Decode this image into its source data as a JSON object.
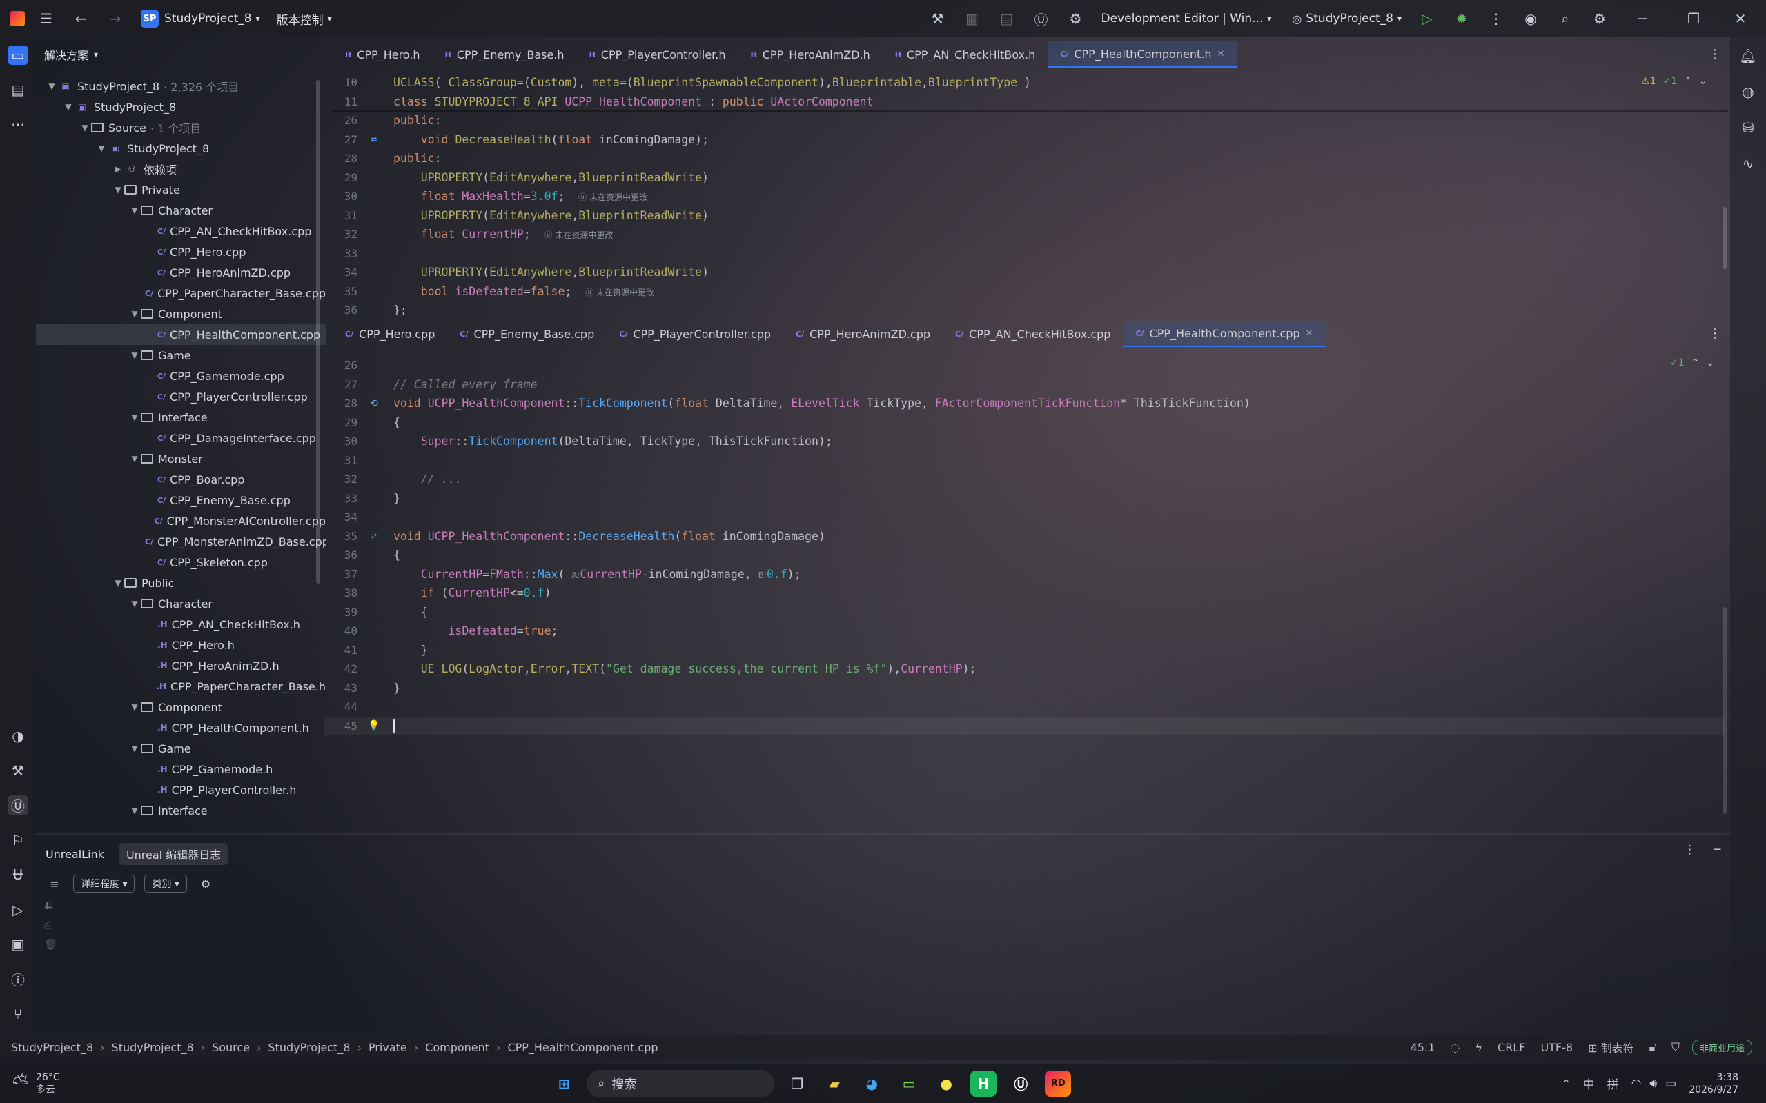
{
  "titlebar": {
    "project": "StudyProject_8",
    "project_badge": "SP",
    "vcs": "版本控制",
    "config": "Development Editor | Win...",
    "run_target": "StudyProject_8"
  },
  "solution": {
    "header": "解决方案"
  },
  "tree": [
    {
      "label": "StudyProject_8",
      "meta": "· 2,326 个项目",
      "indent": 0,
      "arrow": "▼",
      "icon": "sln"
    },
    {
      "label": "StudyProject_8",
      "meta": "",
      "indent": 1,
      "arrow": "▼",
      "icon": "uproj"
    },
    {
      "label": "Source",
      "meta": "· 1 个项目",
      "indent": 2,
      "arrow": "▼",
      "icon": "folder"
    },
    {
      "label": "StudyProject_8",
      "meta": "",
      "indent": 3,
      "arrow": "▼",
      "icon": "proj"
    },
    {
      "label": "依赖项",
      "meta": "",
      "indent": 4,
      "arrow": "▶",
      "icon": "deps"
    },
    {
      "label": "Private",
      "meta": "",
      "indent": 4,
      "arrow": "▼",
      "icon": "folder"
    },
    {
      "label": "Character",
      "meta": "",
      "indent": 5,
      "arrow": "▼",
      "icon": "folder"
    },
    {
      "label": "CPP_AN_CheckHitBox.cpp",
      "meta": "",
      "indent": 6,
      "arrow": "",
      "icon": "cpp"
    },
    {
      "label": "CPP_Hero.cpp",
      "meta": "",
      "indent": 6,
      "arrow": "",
      "icon": "cpp"
    },
    {
      "label": "CPP_HeroAnimZD.cpp",
      "meta": "",
      "indent": 6,
      "arrow": "",
      "icon": "cpp"
    },
    {
      "label": "CPP_PaperCharacter_Base.cpp",
      "meta": "",
      "indent": 6,
      "arrow": "",
      "icon": "cpp"
    },
    {
      "label": "Component",
      "meta": "",
      "indent": 5,
      "arrow": "▼",
      "icon": "folder"
    },
    {
      "label": "CPP_HealthComponent.cpp",
      "meta": "",
      "indent": 6,
      "arrow": "",
      "icon": "cpp",
      "selected": true
    },
    {
      "label": "Game",
      "meta": "",
      "indent": 5,
      "arrow": "▼",
      "icon": "folder"
    },
    {
      "label": "CPP_Gamemode.cpp",
      "meta": "",
      "indent": 6,
      "arrow": "",
      "icon": "cpp"
    },
    {
      "label": "CPP_PlayerController.cpp",
      "meta": "",
      "indent": 6,
      "arrow": "",
      "icon": "cpp"
    },
    {
      "label": "Interface",
      "meta": "",
      "indent": 5,
      "arrow": "▼",
      "icon": "folder"
    },
    {
      "label": "CPP_DamageInterface.cpp",
      "meta": "",
      "indent": 6,
      "arrow": "",
      "icon": "cpp"
    },
    {
      "label": "Monster",
      "meta": "",
      "indent": 5,
      "arrow": "▼",
      "icon": "folder"
    },
    {
      "label": "CPP_Boar.cpp",
      "meta": "",
      "indent": 6,
      "arrow": "",
      "icon": "cpp"
    },
    {
      "label": "CPP_Enemy_Base.cpp",
      "meta": "",
      "indent": 6,
      "arrow": "",
      "icon": "cpp"
    },
    {
      "label": "CPP_MonsterAIController.cpp",
      "meta": "",
      "indent": 6,
      "arrow": "",
      "icon": "cpp"
    },
    {
      "label": "CPP_MonsterAnimZD_Base.cpp",
      "meta": "",
      "indent": 6,
      "arrow": "",
      "icon": "cpp"
    },
    {
      "label": "CPP_Skeleton.cpp",
      "meta": "",
      "indent": 6,
      "arrow": "",
      "icon": "cpp"
    },
    {
      "label": "Public",
      "meta": "",
      "indent": 4,
      "arrow": "▼",
      "icon": "folder"
    },
    {
      "label": "Character",
      "meta": "",
      "indent": 5,
      "arrow": "▼",
      "icon": "folder"
    },
    {
      "label": "CPP_AN_CheckHitBox.h",
      "meta": "",
      "indent": 6,
      "arrow": "",
      "icon": "h"
    },
    {
      "label": "CPP_Hero.h",
      "meta": "",
      "indent": 6,
      "arrow": "",
      "icon": "h"
    },
    {
      "label": "CPP_HeroAnimZD.h",
      "meta": "",
      "indent": 6,
      "arrow": "",
      "icon": "h"
    },
    {
      "label": "CPP_PaperCharacter_Base.h",
      "meta": "",
      "indent": 6,
      "arrow": "",
      "icon": "h"
    },
    {
      "label": "Component",
      "meta": "",
      "indent": 5,
      "arrow": "▼",
      "icon": "folder"
    },
    {
      "label": "CPP_HealthComponent.h",
      "meta": "",
      "indent": 6,
      "arrow": "",
      "icon": "h"
    },
    {
      "label": "Game",
      "meta": "",
      "indent": 5,
      "arrow": "▼",
      "icon": "folder"
    },
    {
      "label": "CPP_Gamemode.h",
      "meta": "",
      "indent": 6,
      "arrow": "",
      "icon": "h"
    },
    {
      "label": "CPP_PlayerController.h",
      "meta": "",
      "indent": 6,
      "arrow": "",
      "icon": "h"
    },
    {
      "label": "Interface",
      "meta": "",
      "indent": 5,
      "arrow": "▼",
      "icon": "folder"
    }
  ],
  "top_tabs": [
    {
      "label": "CPP_Hero.h",
      "icon": "H"
    },
    {
      "label": "CPP_Enemy_Base.h",
      "icon": "H"
    },
    {
      "label": "CPP_PlayerController.h",
      "icon": "H"
    },
    {
      "label": "CPP_HeroAnimZD.h",
      "icon": "H"
    },
    {
      "label": "CPP_AN_CheckHitBox.h",
      "icon": "H"
    },
    {
      "label": "CPP_HealthComponent.h",
      "icon": "C/",
      "active": true
    }
  ],
  "bottom_tabs": [
    {
      "label": "CPP_Hero.cpp",
      "icon": "C/"
    },
    {
      "label": "CPP_Enemy_Base.cpp",
      "icon": "C/"
    },
    {
      "label": "CPP_PlayerController.cpp",
      "icon": "C/"
    },
    {
      "label": "CPP_HeroAnimZD.cpp",
      "icon": "C/"
    },
    {
      "label": "CPP_AN_CheckHitBox.cpp",
      "icon": "C/"
    },
    {
      "label": "CPP_HealthComponent.cpp",
      "icon": "C/",
      "active": true
    }
  ],
  "top_inspection": {
    "warn": "⚠1",
    "ok": "✓1"
  },
  "bottom_inspection": {
    "ok": "✓1"
  },
  "header_code": [
    {
      "n": "10",
      "g": "",
      "html": "<span class='mac'>UCLASS</span>( <span class='mac'>ClassGroup</span>=(<span class='mac'>Custom</span>), <span class='mac'>meta</span>=(<span class='mac'>BlueprintSpawnableComponent</span>),<span class='mac'>Blueprintable</span>,<span class='mac'>BlueprintType</span> )"
    },
    {
      "n": "11",
      "g": "",
      "html": "<span class='kw'>class</span> <span class='mac'>STUDYPROJECT_8_API</span> <span class='ty'>UCPP_HealthComponent</span> : <span class='kw'>public</span> <span class='ty'>UActorComponent</span>"
    },
    {
      "n": "26",
      "g": "",
      "html": "<span class='kw'>public</span>:"
    },
    {
      "n": "27",
      "g": "⇄",
      "html": "    <span class='kw'>void</span> <span class='mac'>DecreaseHealth</span>(<span class='kw'>float</span> inComingDamage);"
    },
    {
      "n": "28",
      "g": "",
      "html": "<span class='kw'>public</span>:"
    },
    {
      "n": "29",
      "g": "",
      "html": "    <span class='mac'>UPROPERTY</span>(<span class='mac'>EditAnywhere</span>,<span class='mac'>BlueprintReadWrite</span>)"
    },
    {
      "n": "30",
      "g": "",
      "html": "    <span class='kw'>float</span> <span class='fld'>MaxHealth</span>=<span class='num'>3.0f</span>;  <span class='hint'>ⓤ 未在资源中更改</span>"
    },
    {
      "n": "31",
      "g": "",
      "html": "    <span class='mac'>UPROPERTY</span>(<span class='mac'>EditAnywhere</span>,<span class='mac'>BlueprintReadWrite</span>)"
    },
    {
      "n": "32",
      "g": "",
      "html": "    <span class='kw'>float</span> <span class='fld'>CurrentHP</span>;  <span class='hint'>ⓤ 未在资源中更改</span>"
    },
    {
      "n": "33",
      "g": "",
      "html": ""
    },
    {
      "n": "34",
      "g": "",
      "html": "    <span class='mac'>UPROPERTY</span>(<span class='mac'>EditAnywhere</span>,<span class='mac'>BlueprintReadWrite</span>)"
    },
    {
      "n": "35",
      "g": "",
      "html": "    <span class='kw'>bool</span> <span class='fld'>isDefeated</span>=<span class='kw'>false</span>;  <span class='hint'>ⓤ 未在资源中更改</span>"
    },
    {
      "n": "36",
      "g": "",
      "html": "};"
    }
  ],
  "cpp_code": [
    {
      "n": "26",
      "g": "",
      "html": ""
    },
    {
      "n": "27",
      "g": "",
      "html": "<span class='cm'>// Called every frame</span>"
    },
    {
      "n": "28",
      "g": "⟲",
      "html": "<span class='kw'>void</span> <span class='ty'>UCPP_HealthComponent</span>::<span class='fn'>TickComponent</span>(<span class='kw'>float</span> DeltaTime, <span class='ty'>ELevelTick</span> TickType, <span class='ty'>FActorComponentTickFunction</span>* ThisTickFunction)"
    },
    {
      "n": "29",
      "g": "",
      "html": "{"
    },
    {
      "n": "30",
      "g": "",
      "html": "    <span class='ty'>Super</span>::<span class='fn'>TickComponent</span>(DeltaTime, TickType, ThisTickFunction);"
    },
    {
      "n": "31",
      "g": "",
      "html": ""
    },
    {
      "n": "32",
      "g": "",
      "html": "    <span class='cm'>// ...</span>"
    },
    {
      "n": "33",
      "g": "",
      "html": "}"
    },
    {
      "n": "34",
      "g": "",
      "html": ""
    },
    {
      "n": "35",
      "g": "⇄",
      "html": "<span class='kw'>void</span> <span class='ty'>UCPP_HealthComponent</span>::<span class='fn'>DecreaseHealth</span>(<span class='kw'>float</span> inComingDamage)"
    },
    {
      "n": "36",
      "g": "",
      "html": "{"
    },
    {
      "n": "37",
      "g": "",
      "html": "    <span class='fld'>CurrentHP</span>=<span class='ty'>FMath</span>::<span class='fn'>Max</span>( <span class='hint'>A:</span><span class='fld'>CurrentHP</span>-inComingDamage, <span class='hint'>B:</span><span class='num'>0.f</span>);"
    },
    {
      "n": "38",
      "g": "",
      "html": "    <span class='kw'>if</span> (<span class='fld'>CurrentHP</span>&lt;=<span class='num'>0.f</span>)"
    },
    {
      "n": "39",
      "g": "",
      "html": "    {"
    },
    {
      "n": "40",
      "g": "",
      "html": "        <span class='fld'>isDefeated</span>=<span class='kw'>true</span>;"
    },
    {
      "n": "41",
      "g": "",
      "html": "    }"
    },
    {
      "n": "42",
      "g": "",
      "html": "    <span class='mac'>UE_LOG</span>(<span class='mac'>LogActor</span>,<span class='mac'>Error</span>,<span class='mac'>TEXT</span>(<span class='str'>\"Get damage success,the current HP is %f\"</span>),<span class='fld'>CurrentHP</span>);"
    },
    {
      "n": "43",
      "g": "",
      "html": "}"
    },
    {
      "n": "44",
      "g": "",
      "html": ""
    },
    {
      "n": "45",
      "g": "💡",
      "html": "<span style='border-left:2px solid #dfe1e5'>&#8203;</span>"
    }
  ],
  "bottom_panel": {
    "title": "UnrealLink",
    "tab": "Unreal 编辑器日志",
    "filter1": "详细程度",
    "filter2": "类别"
  },
  "breadcrumb": [
    "StudyProject_8",
    "StudyProject_8",
    "Source",
    "StudyProject_8",
    "Private",
    "Component",
    "CPP_HealthComponent.cpp"
  ],
  "status": {
    "pos": "45:1",
    "crlf": "CRLF",
    "enc": "UTF-8",
    "tab": "制表符",
    "license": "非商业用途"
  },
  "taskbar": {
    "temp": "26°C",
    "weather": "多云",
    "search": "搜索",
    "ime1": "中",
    "ime2": "拼",
    "time": "3:38",
    "date": "2026/9/27"
  },
  "colors": {
    "accent": "#3574f0"
  }
}
